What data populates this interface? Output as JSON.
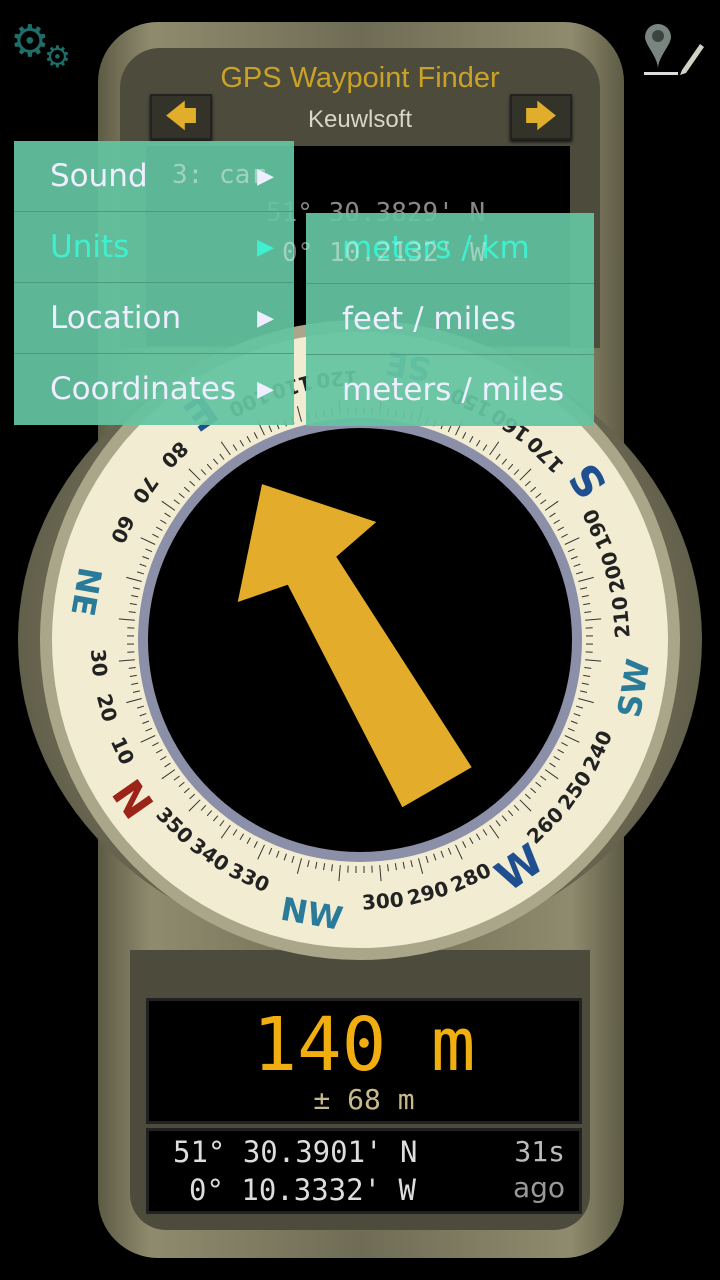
{
  "header": {
    "title": "GPS Waypoint Finder",
    "subtitle": "Keuwlsoft",
    "prev_icon": "arrow-left-icon",
    "next_icon": "arrow-right-icon",
    "prev_glyph": "🡄",
    "next_glyph": "🡆"
  },
  "toolbar": {
    "settings_icon": "gears-icon",
    "waypoint_edit_icon": "map-pin-edit-icon"
  },
  "waypoint_screen": {
    "name": "3: car",
    "lat": "51° 30.3829' N",
    "lon": "0° 10.2132' W"
  },
  "menu": {
    "items": [
      {
        "label": "Sound"
      },
      {
        "label": "Units",
        "selected": true
      },
      {
        "label": "Location"
      },
      {
        "label": "Coordinates"
      }
    ],
    "submenu": [
      {
        "label": "meters / km",
        "selected": true
      },
      {
        "label": "feet / miles"
      },
      {
        "label": "meters / miles"
      }
    ],
    "arrow": "▶"
  },
  "compass": {
    "dial_rotation_deg": 235,
    "arrow_bearing_deg": -30,
    "cardinals": [
      {
        "d": 0,
        "t": "N",
        "c": "#9b2318"
      },
      {
        "d": 45,
        "t": "NE",
        "c": "#2a7a9a"
      },
      {
        "d": 90,
        "t": "E",
        "c": "#1f4f8f"
      },
      {
        "d": 135,
        "t": "SE",
        "c": "#2a7a9a"
      },
      {
        "d": 180,
        "t": "S",
        "c": "#1f4f8f"
      },
      {
        "d": 225,
        "t": "SW",
        "c": "#2a7a9a"
      },
      {
        "d": 270,
        "t": "W",
        "c": "#1f4f8f"
      },
      {
        "d": 315,
        "t": "NW",
        "c": "#2a7a9a"
      }
    ],
    "numbers": [
      "10",
      "20",
      "30",
      "60",
      "70",
      "80",
      "100",
      "110",
      "120",
      "150",
      "160",
      "170",
      "190",
      "200",
      "210",
      "240",
      "250",
      "260",
      "280",
      "290",
      "300",
      "330",
      "340",
      "350"
    ],
    "dial_color": "#f1ecd2",
    "arrow_color": "#e3ad2b"
  },
  "distance": {
    "value": "140 m",
    "accuracy": "± 68 m"
  },
  "position": {
    "lat": "51° 30.3901' N",
    "lon": "0° 10.3332' W",
    "age": "31s",
    "age_suffix": "ago"
  }
}
